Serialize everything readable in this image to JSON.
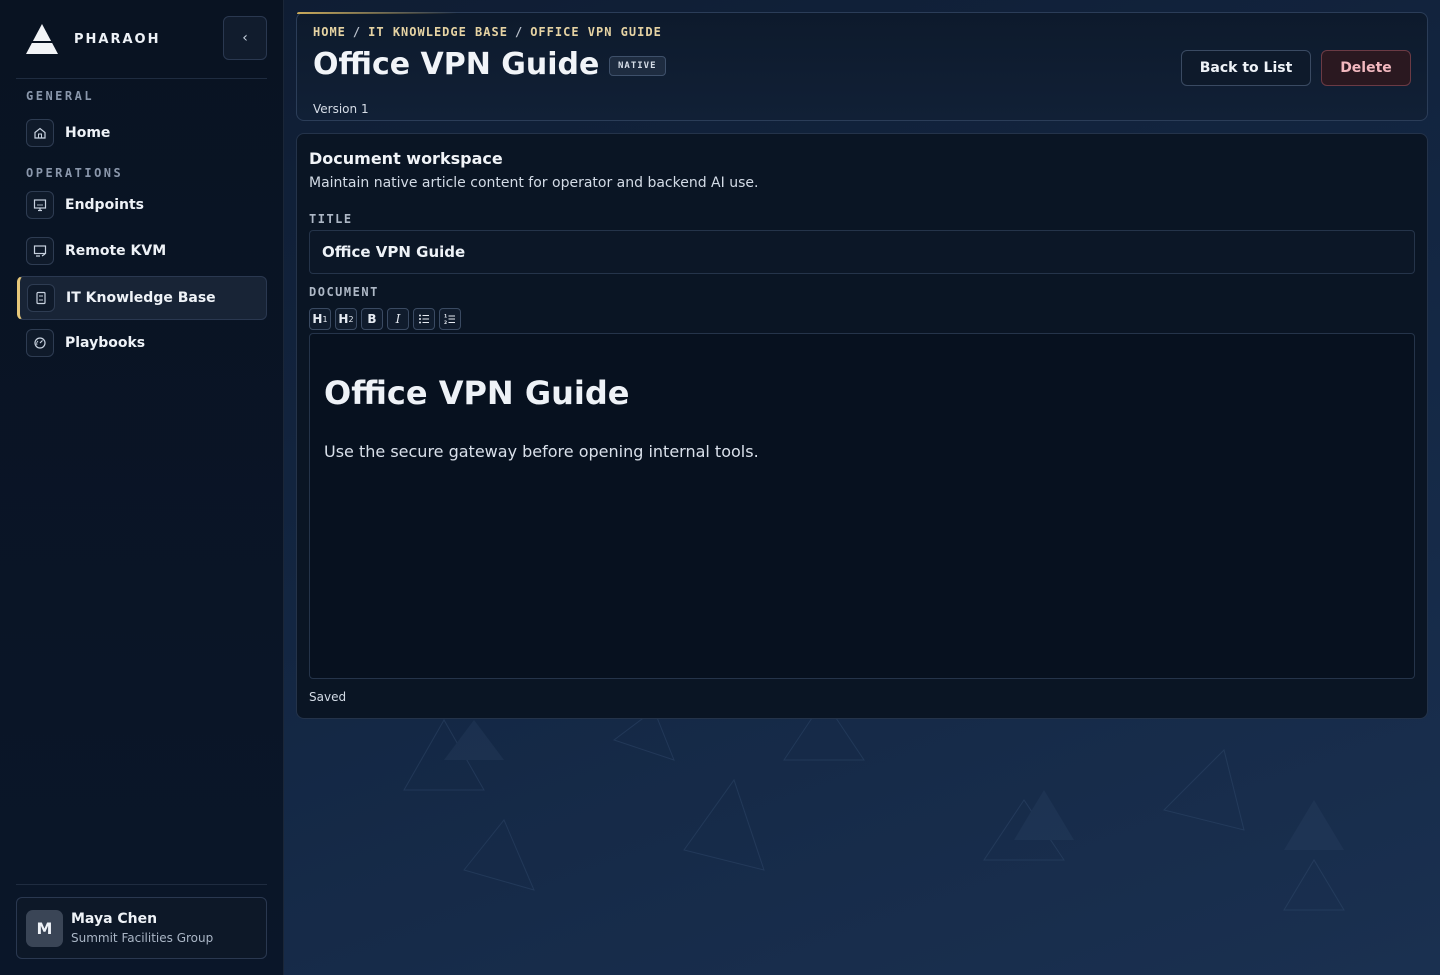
{
  "brand": {
    "name": "PHARAOH"
  },
  "sidebar": {
    "sections": [
      {
        "label": "GENERAL"
      },
      {
        "label": "OPERATIONS"
      }
    ],
    "items": [
      {
        "label": "Home",
        "icon": "home-icon"
      },
      {
        "label": "Endpoints",
        "icon": "monitor-icon"
      },
      {
        "label": "Remote KVM",
        "icon": "remote-screen-icon"
      },
      {
        "label": "IT Knowledge Base",
        "icon": "book-icon",
        "active": true
      },
      {
        "label": "Playbooks",
        "icon": "gauge-icon"
      }
    ],
    "collapse_icon": "chevron-left-icon",
    "user": {
      "initial": "M",
      "name": "Maya Chen",
      "org": "Summit Facilities Group"
    }
  },
  "header": {
    "breadcrumb": [
      "HOME",
      "IT KNOWLEDGE BASE",
      "OFFICE VPN GUIDE"
    ],
    "title": "Office VPN Guide",
    "badge": "NATIVE",
    "version": "Version 1",
    "back_label": "Back to List",
    "delete_label": "Delete"
  },
  "workspace": {
    "title": "Document workspace",
    "description": "Maintain native article content for operator and backend AI use.",
    "title_label": "TITLE",
    "title_value": "Office VPN Guide",
    "document_label": "DOCUMENT",
    "toolbar": [
      "H1",
      "H2",
      "B",
      "I",
      "bullet-list",
      "numbered-list"
    ],
    "doc_heading": "Office VPN Guide",
    "doc_paragraph": "Use the secure gateway before opening internal tools.",
    "status": "Saved"
  },
  "colors": {
    "accent": "#e6c77a",
    "delete": "#f2b8bf",
    "background": "#0b1627"
  }
}
